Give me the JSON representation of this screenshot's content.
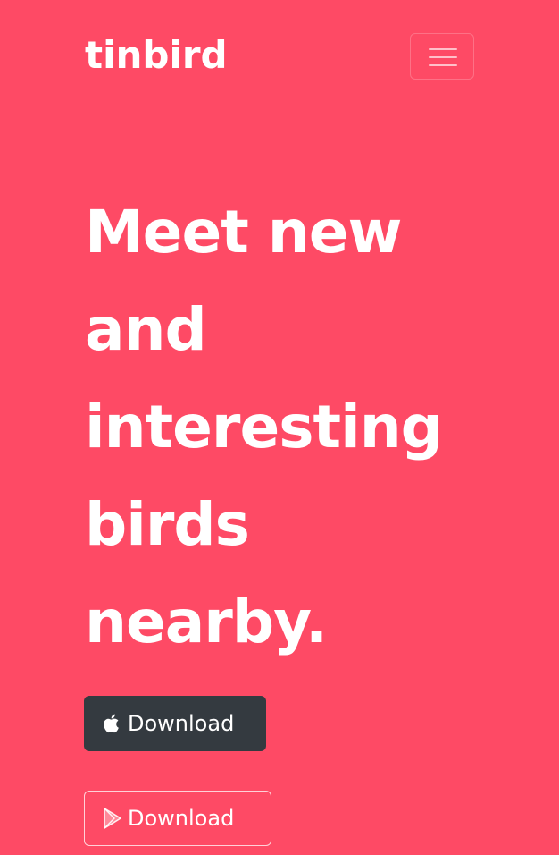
{
  "brand": {
    "name": "tinbird"
  },
  "navbar": {
    "toggle_icon": "hamburger-menu-icon"
  },
  "hero": {
    "headline_lines": [
      "Meet new",
      "and",
      "interesting",
      "birds",
      "nearby."
    ]
  },
  "buttons": {
    "app_store": {
      "label": "Download",
      "icon": "apple-icon",
      "color": "#343a40"
    },
    "play_store": {
      "label": "Download",
      "icon": "google-play-icon",
      "style": "outline"
    }
  },
  "colors": {
    "background": "#fe4a65",
    "text": "#ffffff"
  }
}
